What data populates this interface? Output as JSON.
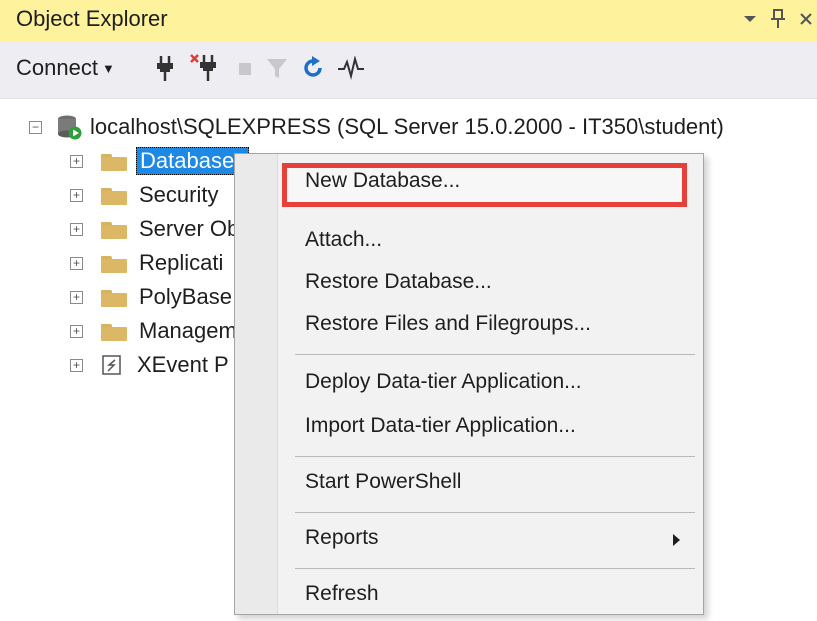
{
  "window": {
    "title": "Object Explorer",
    "icons": [
      "dropdown-icon",
      "pin-icon",
      "close-icon"
    ]
  },
  "toolbar": {
    "connect_label": "Connect",
    "tools": [
      "connect-plug-icon",
      "disconnect-icon",
      "stop-icon",
      "filter-icon",
      "refresh-icon",
      "activity-monitor-icon"
    ]
  },
  "tree": {
    "root": {
      "label": "localhost\\SQLEXPRESS (SQL Server 15.0.2000 - IT350\\student)",
      "expander": "−"
    },
    "children": [
      {
        "label": "Databases",
        "selected": true,
        "expander": "+"
      },
      {
        "label": "Security",
        "expander": "+"
      },
      {
        "label": "Server Ob",
        "expander": "+"
      },
      {
        "label": "Replicati",
        "expander": "+"
      },
      {
        "label": "PolyBase",
        "expander": "+"
      },
      {
        "label": "Managem",
        "expander": "+"
      },
      {
        "label": "XEvent P",
        "expander": "+"
      }
    ]
  },
  "context_menu": {
    "items": [
      {
        "label": "New Database...",
        "highlighted": true
      },
      {
        "label": "Attach..."
      },
      {
        "label": "Restore Database..."
      },
      {
        "label": "Restore Files and Filegroups..."
      },
      {
        "label": "Deploy Data-tier Application..."
      },
      {
        "label": "Import Data-tier Application..."
      },
      {
        "label": "Start PowerShell"
      },
      {
        "label": "Reports",
        "submenu": true
      },
      {
        "label": "Refresh"
      }
    ]
  },
  "colors": {
    "titlebar": "#fff29d",
    "selection": "#1e88e5",
    "highlight_box": "#e7403a"
  }
}
